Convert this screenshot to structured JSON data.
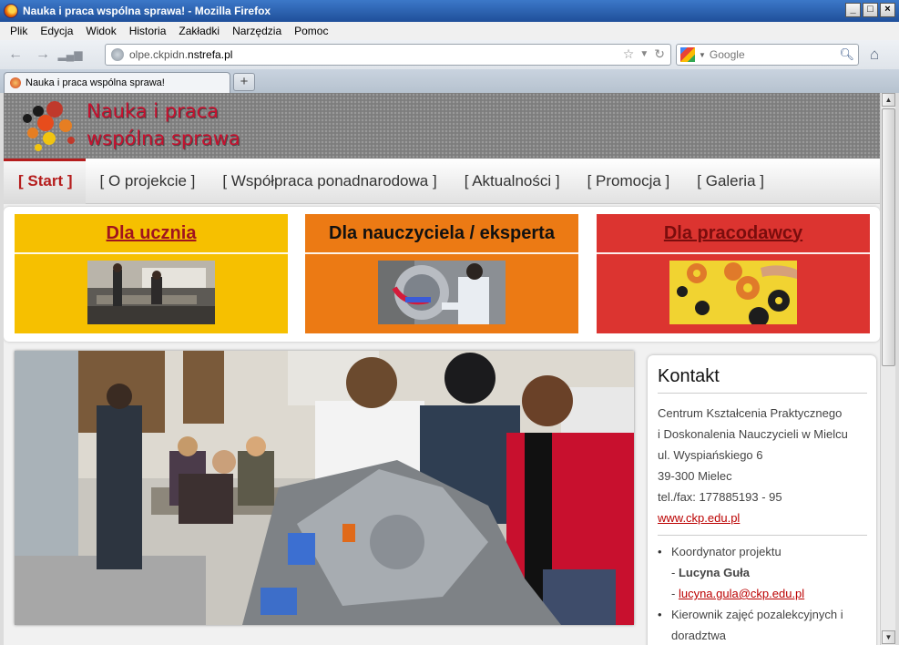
{
  "window": {
    "title": "Nauka i praca wspólna sprawa! - Mozilla Firefox",
    "controls": [
      "_",
      "□",
      "×"
    ]
  },
  "menu": [
    "Plik",
    "Edycja",
    "Widok",
    "Historia",
    "Zakładki",
    "Narzędzia",
    "Pomoc"
  ],
  "toolbar": {
    "url_prefix": "olpe.ckpidn.",
    "url_domain": "nstrefa.pl",
    "search_placeholder": "Google"
  },
  "tab": {
    "title": "Nauka i praca wspólna sprawa!",
    "new_tab": "+"
  },
  "site": {
    "title_line1": "Nauka i praca",
    "title_line2": "wspólna sprawa",
    "nav": [
      "[ Start ]",
      "[ O projekcie ]",
      "[ Współpraca ponadnarodowa ]",
      "[ Aktualności ]",
      "[ Promocja ]",
      "[ Galeria ]"
    ],
    "categories": [
      {
        "label": "Dla ucznia",
        "bg": "#f6c000",
        "color": "#a0141e",
        "link": true
      },
      {
        "label": "Dla nauczyciela / eksperta",
        "bg": "#ec7a14",
        "color": "#111111",
        "link": false
      },
      {
        "label": "Dla pracodawcy",
        "bg": "#dc3430",
        "color": "#7a0d0d",
        "link": true
      }
    ]
  },
  "contact": {
    "heading": "Kontakt",
    "lines": [
      "Centrum Kształcenia Praktycznego",
      "i Doskonalenia Nauczycieli w Mielcu",
      "ul. Wyspiańskiego 6",
      "39-300 Mielec",
      "tel./fax: 177885193 - 95"
    ],
    "website": "www.ckp.edu.pl",
    "items": [
      {
        "label": "Koordynator projektu",
        "name": "Lucyna Guła",
        "email": "lucyna.gula@ckp.edu.pl"
      },
      {
        "label": "Kierownik zajęć pozalekcyjnych i doradztwa"
      }
    ]
  }
}
